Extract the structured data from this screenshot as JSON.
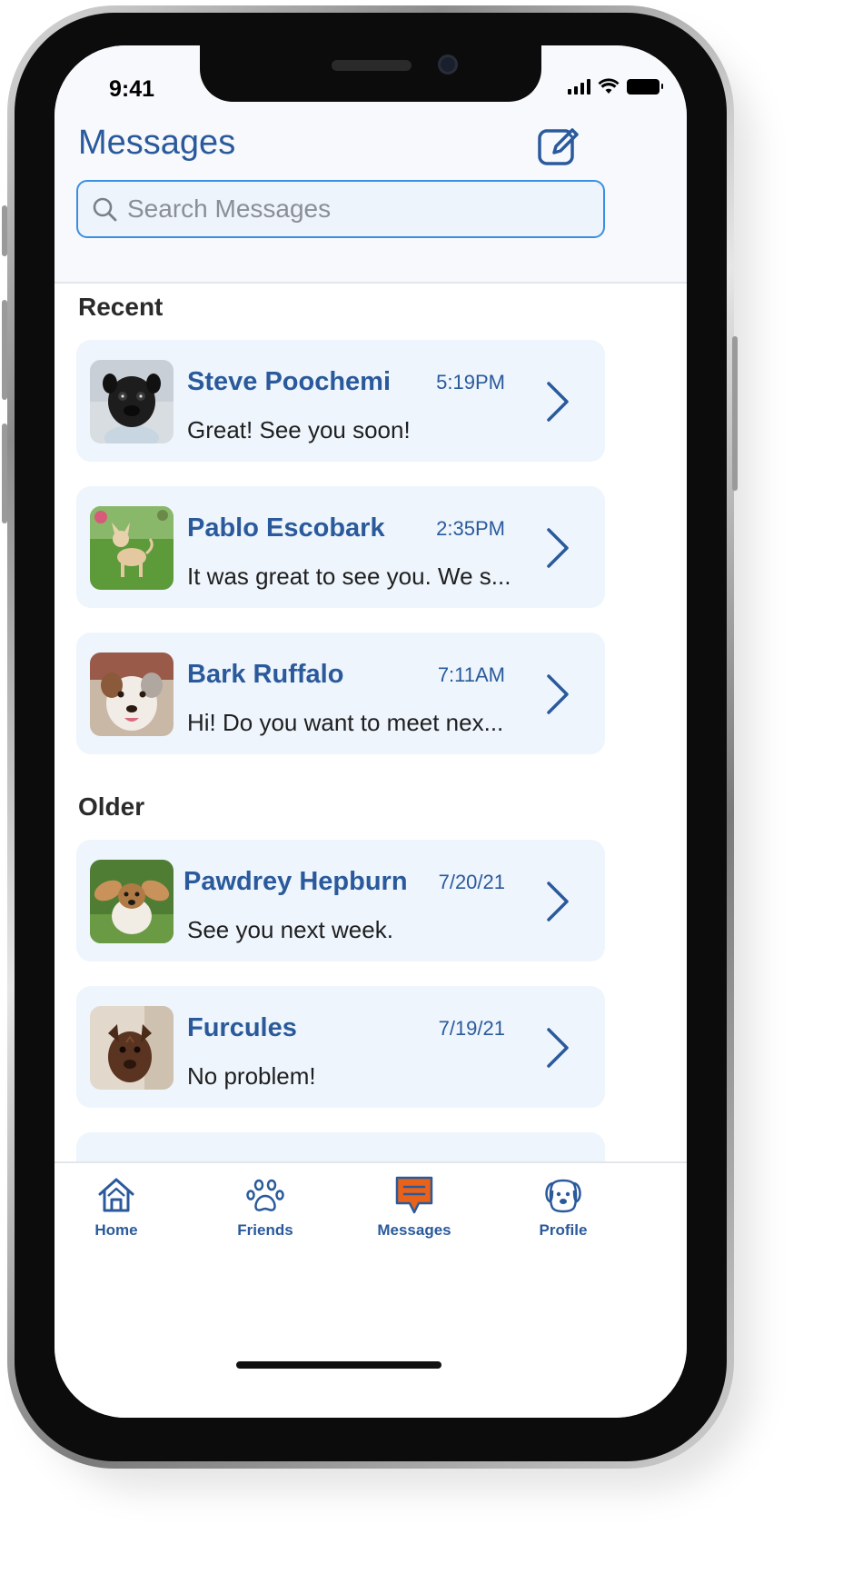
{
  "status_bar": {
    "time": "9:41"
  },
  "header": {
    "title": "Messages",
    "compose_icon": "compose-icon",
    "search_placeholder": "Search Messages"
  },
  "sections": {
    "recent_title": "Recent",
    "older_title": "Older"
  },
  "conversations": [
    {
      "name": "Steve Poochemi",
      "time": "5:19PM",
      "preview": "Great! See you soon!",
      "avatar": "pug-avatar"
    },
    {
      "name": "Pablo Escobark",
      "time": "2:35PM",
      "preview": "It was great to see you. We s...",
      "avatar": "chihuahua-avatar"
    },
    {
      "name": "Bark Ruffalo",
      "time": "7:11AM",
      "preview": "Hi! Do you want to meet nex...",
      "avatar": "aussie-avatar"
    },
    {
      "name": "Pawdrey Hepburn",
      "time": "7/20/21",
      "preview": "See you next week.",
      "avatar": "terrier-avatar"
    },
    {
      "name": "Furcules",
      "time": "7/19/21",
      "preview": "No problem!",
      "avatar": "pitbull-avatar"
    }
  ],
  "tabs": [
    {
      "label": "Home",
      "icon": "home-icon",
      "active": false
    },
    {
      "label": "Friends",
      "icon": "paw-icon",
      "active": false
    },
    {
      "label": "Messages",
      "icon": "chat-icon",
      "active": true
    },
    {
      "label": "Profile",
      "icon": "dog-face-icon",
      "active": false
    }
  ],
  "colors": {
    "primary": "#2a5a9b",
    "accent": "#e8621a",
    "search_border": "#3b8fe0",
    "card_bg": "#eef5fd"
  }
}
